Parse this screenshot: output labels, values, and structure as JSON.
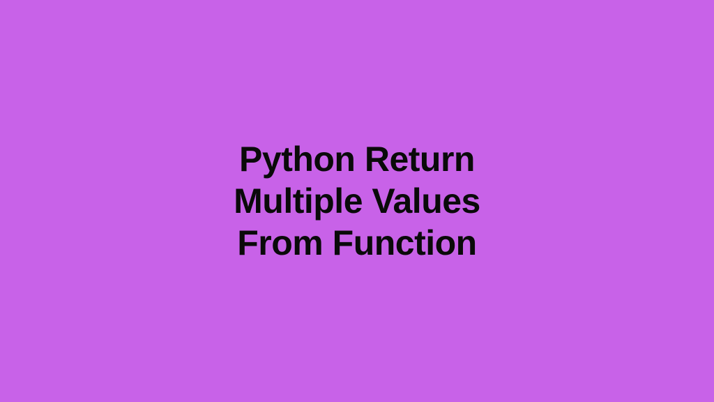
{
  "title": {
    "line1": "Python Return",
    "line2": "Multiple Values",
    "line3": "From Function"
  },
  "colors": {
    "background": "#c862e8",
    "text": "#0a0a0a"
  }
}
